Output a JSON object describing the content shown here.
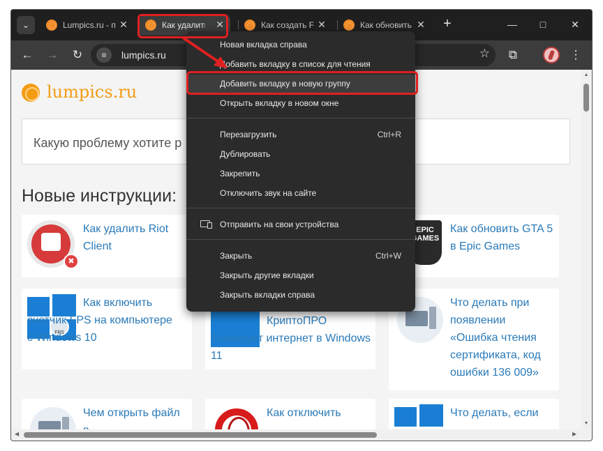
{
  "tabs": [
    {
      "title": "Lumpics.ru - п",
      "active": false
    },
    {
      "title": "Как удалить ...",
      "active": true
    },
    {
      "title": "Как создать F",
      "active": false
    },
    {
      "title": "Как обновить",
      "active": false
    }
  ],
  "toolbar": {
    "url": "lumpics.ru"
  },
  "page": {
    "logo_text": "lumpics.ru",
    "search_placeholder": "Какую проблему хотите р",
    "section_title": "Новые инструкции:",
    "cards": [
      {
        "title": "Как удалить Riot Client"
      },
      {
        "title": "Как обновить GTA 5 в Epic Games",
        "icon_text": "EPIC GAMES"
      },
      {
        "title": "Как включить счетчик FPS на компьютере с Windows 10",
        "badge": "FPS"
      },
      {
        "title": "КриптоПРО блокирует интернет в Windows 11"
      },
      {
        "title": "Что делать при появлении «Ошибка чтения сертификата, код ошибки 136 009»"
      },
      {
        "title": "Чем открыть файл в"
      },
      {
        "title": "Как отключить"
      },
      {
        "title": "Что делать, если"
      }
    ]
  },
  "context_menu": {
    "items": [
      {
        "label": "Новая вкладка справа",
        "shortcut": ""
      },
      {
        "label": "Добавить вкладку в список для чтения",
        "shortcut": ""
      },
      {
        "label": "Добавить вкладку в новую группу",
        "shortcut": ""
      },
      {
        "label": "Открыть вкладку в новом окне",
        "shortcut": ""
      },
      {
        "label": "Перезагрузить",
        "shortcut": "Ctrl+R"
      },
      {
        "label": "Дублировать",
        "shortcut": ""
      },
      {
        "label": "Закрепить",
        "shortcut": ""
      },
      {
        "label": "Отключить звук на сайте",
        "shortcut": ""
      },
      {
        "label": "Отправить на свои устройства",
        "shortcut": ""
      },
      {
        "label": "Закрыть",
        "shortcut": "Ctrl+W"
      },
      {
        "label": "Закрыть другие вкладки",
        "shortcut": ""
      },
      {
        "label": "Закрыть вкладки справа",
        "shortcut": ""
      }
    ]
  },
  "colors": {
    "accent_orange": "#f39c12",
    "link_blue": "#2a7ab8",
    "annotation_red": "#e02020",
    "menu_bg": "#2b2b2b"
  }
}
